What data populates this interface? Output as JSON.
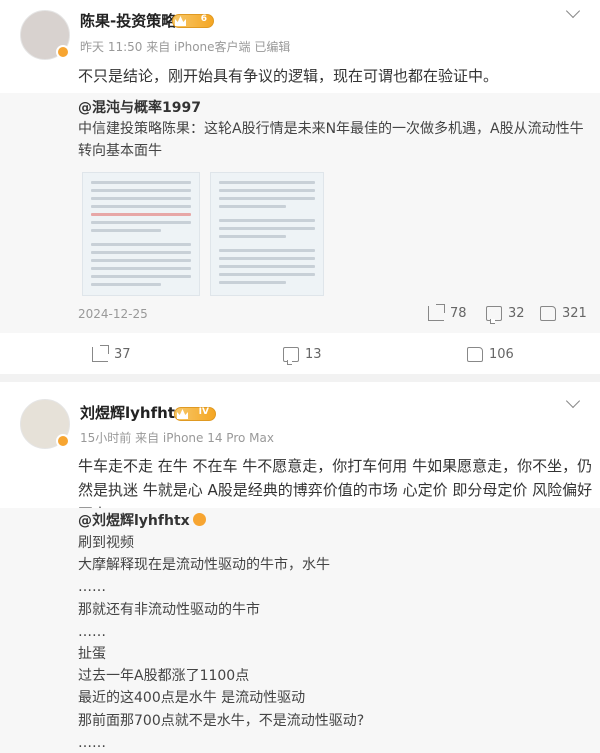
{
  "post1": {
    "author": "陈果-投资策略",
    "level": "6",
    "meta": "昨天 11:50  来自 iPhone客户端  已编辑",
    "text": "不只是结论，刚开始具有争议的逻辑，现在可谓也都在验证中。",
    "quote": {
      "author": "@混沌与概率1997",
      "text": "中信建投策略陈果：这轮A股行情是未来N年最佳的一次做多机遇，A股从流动性牛转向基本面牛",
      "date": "2024-12-25",
      "reposts": "78",
      "comments": "32",
      "likes": "321"
    },
    "reposts": "37",
    "comments": "13",
    "likes": "106"
  },
  "post2": {
    "author": "刘煜辉lyhfhtx",
    "level": "IV",
    "meta": "15小时前  来自 iPhone 14 Pro Max",
    "text": "牛车走不走 在牛 不在车 牛不愿意走，你打车何用 牛如果愿意走，你不坐，仍然是执迷 牛就是心 A股是经典的博弈价值的市场 心定价 即分母定价 风险偏好 至上",
    "quote": {
      "author": "@刘煜辉lyhfhtx",
      "lines": [
        "刷到视频",
        "大摩解释现在是流动性驱动的牛市，水牛",
        "……",
        "那就还有非流动性驱动的牛市",
        "……",
        "扯蛋",
        "过去一年A股都涨了1100点",
        "最近的这400点是水牛 是流动性驱动",
        "那前面那700点就不是水牛，不是流动性驱动?",
        "……"
      ]
    }
  }
}
